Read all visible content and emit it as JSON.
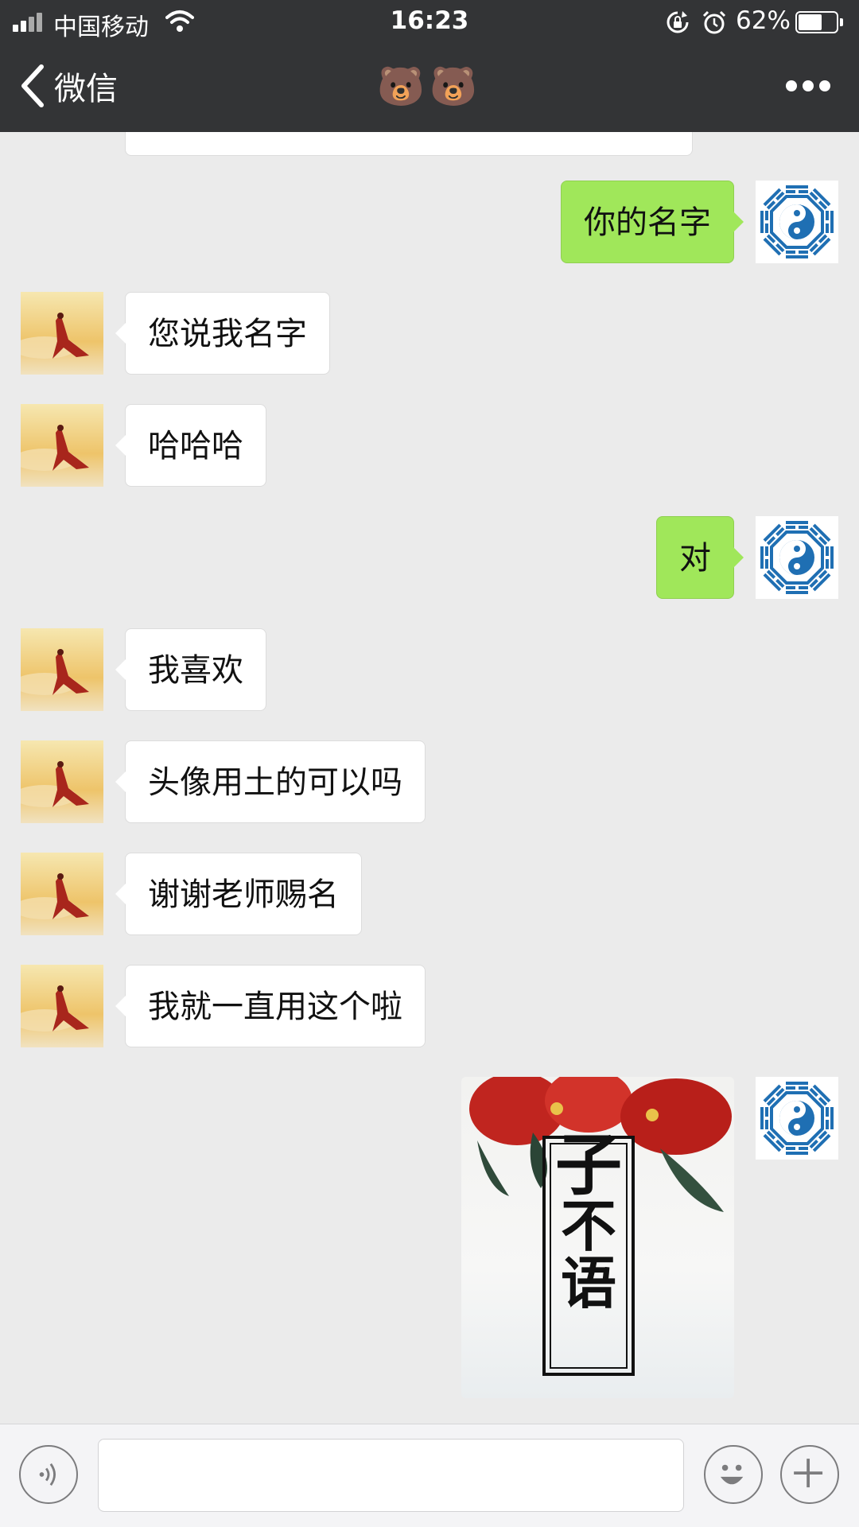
{
  "status_bar": {
    "carrier": "中国移动",
    "time": "16:23",
    "battery_percent_label": "62%",
    "battery_level": 0.62,
    "icons": [
      "signal-icon",
      "wifi-icon",
      "rotation-lock-icon",
      "alarm-icon",
      "battery-icon"
    ]
  },
  "nav": {
    "back_label": "微信",
    "title": "🐻🐻",
    "more_icon": "more-dots-icon"
  },
  "messages": [
    {
      "side": "out",
      "text": "你的名字"
    },
    {
      "side": "in",
      "text": "您说我名字"
    },
    {
      "side": "in",
      "text": "哈哈哈"
    },
    {
      "side": "out",
      "text": "对"
    },
    {
      "side": "in",
      "text": "我喜欢"
    },
    {
      "side": "in",
      "text": "头像用土的可以吗"
    },
    {
      "side": "in",
      "text": "谢谢老师赐名"
    },
    {
      "side": "in",
      "text": "我就一直用这个啦"
    },
    {
      "side": "out",
      "type": "image",
      "image_text": "子不语"
    }
  ],
  "input_bar": {
    "voice_icon": "voice-icon",
    "emoji_icon": "emoji-icon",
    "plus_icon": "plus-icon",
    "input_value": ""
  },
  "colors": {
    "header_bg": "#333436",
    "chat_bg": "#ebebeb",
    "outgoing_bubble": "#a0e75a",
    "incoming_bubble": "#ffffff"
  }
}
